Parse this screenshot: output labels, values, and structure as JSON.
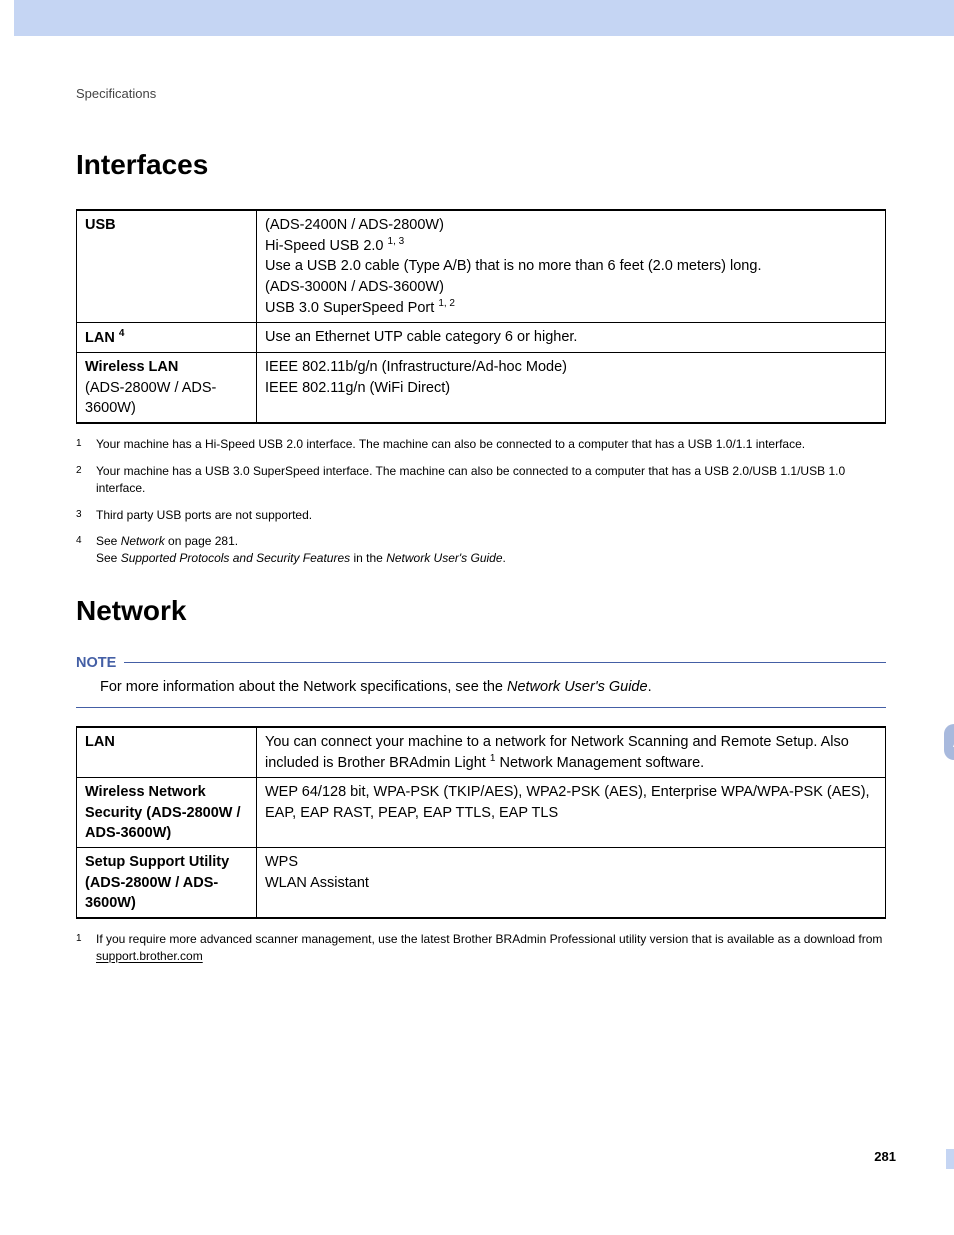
{
  "breadcrumb": "Specifications",
  "section1": {
    "title": "Interfaces",
    "table": {
      "r1": {
        "label": "USB",
        "l1": "(ADS-2400N / ADS-2800W)",
        "l2a": "Hi-Speed USB 2.0 ",
        "l2b": "1, 3",
        "l3": "Use a USB 2.0 cable (Type A/B) that is no more than 6 feet (2.0 meters) long.",
        "l4": "(ADS-3000N / ADS-3600W)",
        "l5a": "USB 3.0 SuperSpeed Port ",
        "l5b": "1, 2"
      },
      "r2": {
        "label_a": "LAN ",
        "label_b": "4",
        "value": "Use an Ethernet UTP cable category 6 or higher."
      },
      "r3": {
        "label_a": "Wireless LAN",
        "label_b": "(ADS-2800W / ADS-3600W)",
        "l1": "IEEE 802.11b/g/n (Infrastructure/Ad-hoc Mode)",
        "l2": "IEEE 802.11g/n (WiFi Direct)"
      }
    },
    "footnotes": {
      "f1": {
        "num": "1",
        "text": "Your machine has a Hi-Speed USB 2.0 interface. The machine can also be connected to a computer that has a USB 1.0/1.1 interface."
      },
      "f2": {
        "num": "2",
        "text": "Your machine has a USB 3.0 SuperSpeed interface. The machine can also be connected to a computer that has a USB 2.0/USB 1.1/USB 1.0 interface."
      },
      "f3": {
        "num": "3",
        "text": "Third party USB ports are not supported."
      },
      "f4": {
        "num": "4",
        "p1a": "See ",
        "p1b": "Network",
        "p1c": " on page 281.",
        "p2a": "See ",
        "p2b": "Supported Protocols and Security Features",
        "p2c": " in the ",
        "p2d": "Network User's Guide",
        "p2e": "."
      }
    }
  },
  "section2": {
    "title": "Network",
    "note": {
      "label": "NOTE",
      "body_a": "For more information about the Network specifications, see the ",
      "body_b": "Network User's Guide",
      "body_c": "."
    },
    "table": {
      "r1": {
        "label": "LAN",
        "l1a": "You can connect your machine to a network for Network Scanning and Remote Setup. Also included is Brother BRAdmin Light ",
        "l1b": "1",
        "l1c": " Network Management software."
      },
      "r2": {
        "label": "Wireless Network Security (ADS-2800W / ADS-3600W)",
        "value": "WEP 64/128 bit, WPA-PSK (TKIP/AES), WPA2-PSK (AES), Enterprise WPA/WPA-PSK (AES), EAP, EAP RAST, PEAP, EAP TTLS, EAP TLS"
      },
      "r3": {
        "label": "Setup Support Utility (ADS-2800W / ADS-3600W)",
        "l1": "WPS",
        "l2": "WLAN Assistant"
      }
    },
    "footnotes": {
      "f1": {
        "num": "1",
        "a": "If you require more advanced scanner management, use the latest Brother BRAdmin Professional utility version that is available as a download from ",
        "b": "support.brother.com"
      }
    }
  },
  "sideTab": "A",
  "pageNumber": "281"
}
